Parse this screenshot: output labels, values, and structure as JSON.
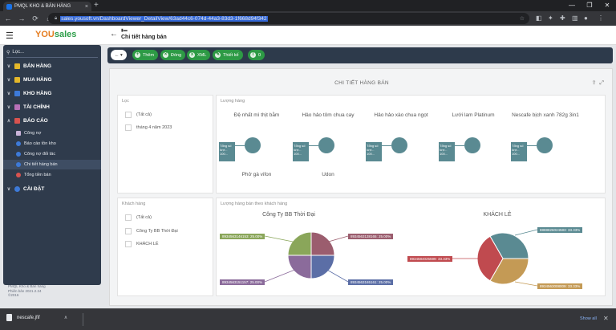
{
  "browser": {
    "tab_title": "PMQL KHO & BÁN HÀNG",
    "tab_close": "×",
    "new_tab": "+",
    "url": "sales.yousoft.vn/DashboardViewer_DetailView/63ad44c6-074d-44a3-83d3-1f668d94f342",
    "window_controls": [
      "—",
      "❐",
      "✕"
    ]
  },
  "app": {
    "logo_you": "YOU",
    "logo_sales": "sales",
    "page_title": "Chi tiết hàng bán",
    "page_icon_text": "▮▬"
  },
  "sidebar": {
    "search_placeholder": "Lọc...",
    "menu": [
      {
        "label": "BÁN HÀNG",
        "color": "#e5b82a"
      },
      {
        "label": "MUA HÀNG",
        "color": "#e5b82a"
      },
      {
        "label": "KHO HÀNG",
        "color": "#3d7ad9"
      },
      {
        "label": "TÀI CHÍNH",
        "color": "#b870b8"
      },
      {
        "label": "BÁO CÁO",
        "color": "#d9534f"
      }
    ],
    "sub_items": [
      {
        "label": "Công nợ",
        "color": "#c9b3d9"
      },
      {
        "label": "Báo cáo tồn kho",
        "color": "#3d7ad9"
      },
      {
        "label": "Công nợ đối tác",
        "color": "#3d7ad9"
      },
      {
        "label": "Chi tiết hàng bán",
        "color": "#3d7ad9"
      },
      {
        "label": "Tổng tiền bán",
        "color": "#d9534f"
      }
    ],
    "settings_label": "CÀI ĐẶT",
    "version_lines": [
      "PMQL Kho & Bán hàng",
      "Phiên bản 2021.2.24",
      "©2016"
    ]
  },
  "actions": {
    "back": "←",
    "add": "Thêm",
    "close": "Đóng",
    "xml": "XML",
    "design": "Thiết kế",
    "count": "0"
  },
  "dashboard": {
    "title": "CHI TIẾT HÀNG BÁN",
    "filter_date": {
      "title": "Lọc",
      "items": [
        "(Tất cả)",
        "tháng 4 năm 2023"
      ]
    },
    "filter_customer": {
      "title": "Khách hàng",
      "items": [
        "(Tất cả)",
        "Công Ty BB Thời Đại",
        "KHÁCH LẺ"
      ]
    },
    "bubble_panel": {
      "title": "Lượng hàng",
      "items": [
        {
          "name": "Đệ nhất mì thịt bằm",
          "tip": "Tổng số lượ... 100..."
        },
        {
          "name": "Hảo hảo tôm chua cay",
          "tip": "Tổng số lượ... 100..."
        },
        {
          "name": "Hảo hảo xào chua ngọt",
          "tip": "Tổng số lượ... 100..."
        },
        {
          "name": "Lưới lam Platinum",
          "tip": "Tổng số lượ... 100..."
        },
        {
          "name": "Nescafe bịch xanh 782g 3in1",
          "tip": "Tổng số lượ... 100..."
        }
      ],
      "bottom_items": [
        "Phở gà vifon",
        "Udon"
      ],
      "color": "#5a8a92"
    },
    "pie_panel": {
      "title": "Lượng hàng bán theo khách hàng",
      "pies": [
        {
          "title": "Công Ty BB Thời Đại",
          "slices": [
            {
              "label": "8934563138165: 25.00%",
              "value": 25,
              "color": "#9b5d6e"
            },
            {
              "label": "8934563165161: 25.00%",
              "value": 25,
              "color": "#5b6ea6"
            },
            {
              "label": "8934563151157: 25.00%",
              "value": 25,
              "color": "#8b6b9b"
            },
            {
              "label": "8934563146153: 25.00%",
              "value": 25,
              "color": "#8aa65a"
            }
          ]
        },
        {
          "title": "KHÁCH LẺ",
          "slices": [
            {
              "label": "8888826024583: 33.33%",
              "value": 33.33,
              "color": "#5a8a92"
            },
            {
              "label": "8934563008009: 33.33%",
              "value": 33.33,
              "color": "#c49a55"
            },
            {
              "label": "8934584025599: 33.33%",
              "value": 33.33,
              "color": "#c04a4f"
            }
          ]
        }
      ]
    }
  },
  "downloads": {
    "file": "nescafe.jfif",
    "show_all": "Show all",
    "close": "✕"
  }
}
